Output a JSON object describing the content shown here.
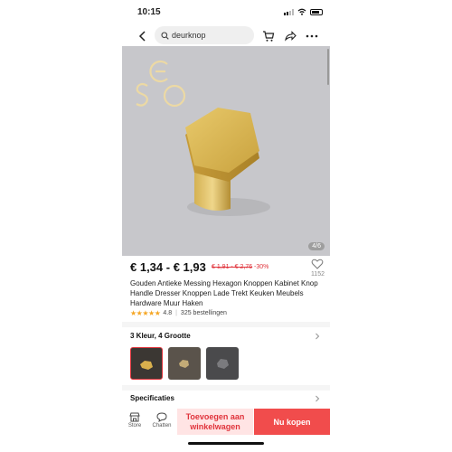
{
  "status_bar": {
    "time": "10:15",
    "icons": [
      "signal-icon",
      "wifi-icon",
      "battery-icon"
    ]
  },
  "nav": {
    "search_text": "deurknop",
    "icons": [
      "back-arrow-icon",
      "search-icon",
      "cart-icon",
      "share-icon",
      "more-icon"
    ]
  },
  "gallery": {
    "counter": "4/6",
    "logo_letters": "ESO"
  },
  "product": {
    "price": "€ 1,34 - € 1,93",
    "original_price": "€ 1,91 - € 2,76",
    "discount": "-30%",
    "favorites_count": "1152",
    "title": "Gouden Antieke Messing Hexagon Knoppen Kabinet Knop Handle Dresser Knoppen Lade Trekt Keuken Meubels Hardware Muur Haken",
    "rating": "4.8",
    "rating_value": 4.8,
    "orders": "325 bestellingen"
  },
  "variants": {
    "heading": "3 Kleur, 4 Grootte",
    "selected_index": 0,
    "count": 3
  },
  "specs": {
    "heading": "Specificaties"
  },
  "bottom_bar": {
    "store_label": "Store",
    "chat_label": "Chatten",
    "add_to_cart": "Toevoegen aan winkelwagen",
    "buy_now": "Nu kopen"
  },
  "colors": {
    "accent": "#e0333b",
    "buy_button": "#f14c4c",
    "cart_button_bg": "#ffe4e4",
    "star": "#f5a623",
    "brass": "#d6b24e"
  }
}
